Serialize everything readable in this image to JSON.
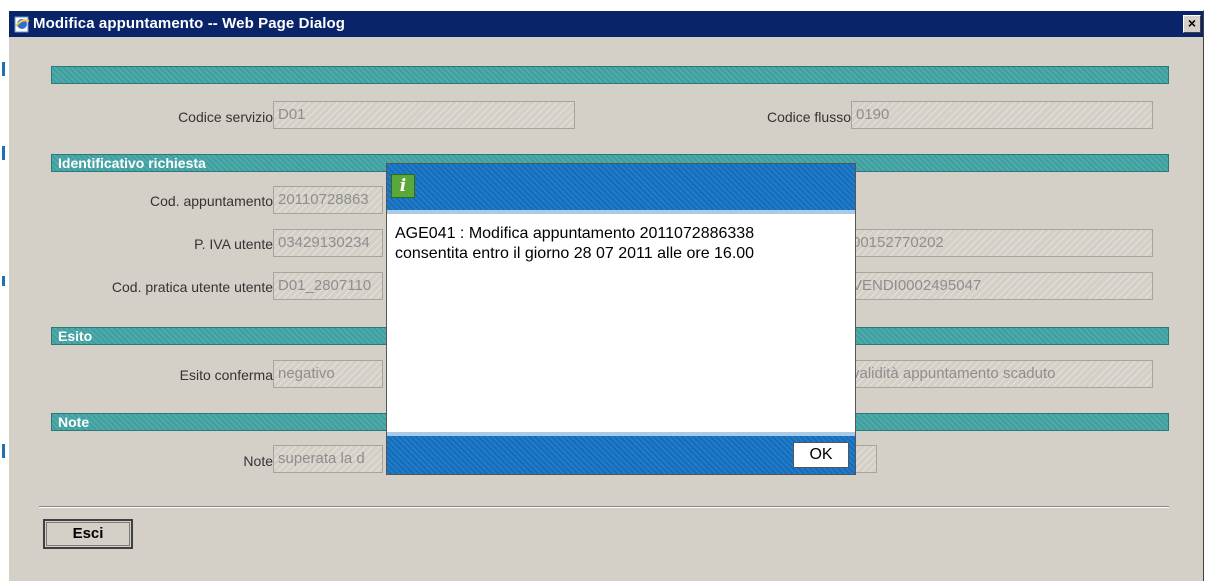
{
  "window": {
    "title": "Modifica appuntamento -- Web Page Dialog",
    "close_label": "×"
  },
  "sections": {
    "identificativo": "Identificativo richiesta",
    "esito": "Esito",
    "note": "Note"
  },
  "fields": {
    "codice_servizio": {
      "label": "Codice servizio",
      "value": "D01"
    },
    "codice_flusso": {
      "label": "Codice flusso",
      "value": "0190"
    },
    "cod_appuntamento": {
      "label": "Cod. appuntamento",
      "value": "20110728863"
    },
    "piva_utente": {
      "label": "P. IVA utente",
      "value": "03429130234"
    },
    "piva_right": {
      "value": "00152770202"
    },
    "cod_pratica": {
      "label": "Cod. pratica utente utente",
      "value": "D01_2807110"
    },
    "cod_pratica_right": {
      "value": "VENDI0002495047"
    },
    "esito_conferma": {
      "label": "Esito conferma",
      "value": "negativo"
    },
    "esito_right": {
      "value": "validità appuntamento scaduto"
    },
    "note": {
      "label": "Note",
      "value": "superata la d"
    }
  },
  "buttons": {
    "esci": "Esci"
  },
  "message": {
    "icon": "i",
    "line1": "AGE041 : Modifica appuntamento 2011072886338",
    "line2": "consentita entro il giorno 28 07 2011 alle ore 16.00",
    "ok_label": "OK"
  },
  "colors": {
    "title_bar": "#0a246a",
    "section_bar": "#42a4a4",
    "message_header": "#1573c4",
    "info_icon": "#5aa83a"
  }
}
